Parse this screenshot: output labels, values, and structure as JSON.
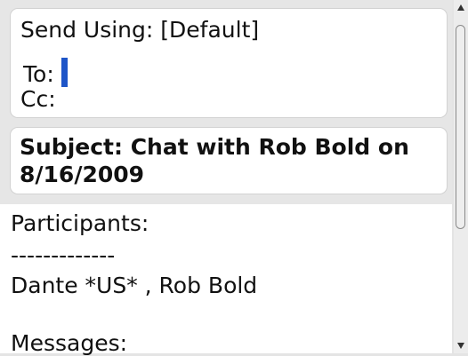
{
  "header": {
    "send_using_label": "Send Using:",
    "send_using_value": "[Default]",
    "to_label": "To:",
    "to_value": "",
    "cc_label": "Cc:",
    "cc_value": ""
  },
  "subject": {
    "text": "Subject: Chat with Rob Bold on 8/16/2009"
  },
  "body": {
    "participants_label": "Participants:",
    "separator": "-------------",
    "participants_value": "Dante *US* , Rob Bold",
    "messages_label": "Messages:"
  },
  "scrollbar": {
    "up_icon": "scroll-up-arrow",
    "down_icon": "scroll-down-arrow"
  },
  "colors": {
    "cursor": "#1e55c8",
    "background": "#e6e6e6",
    "card": "#ffffff"
  }
}
